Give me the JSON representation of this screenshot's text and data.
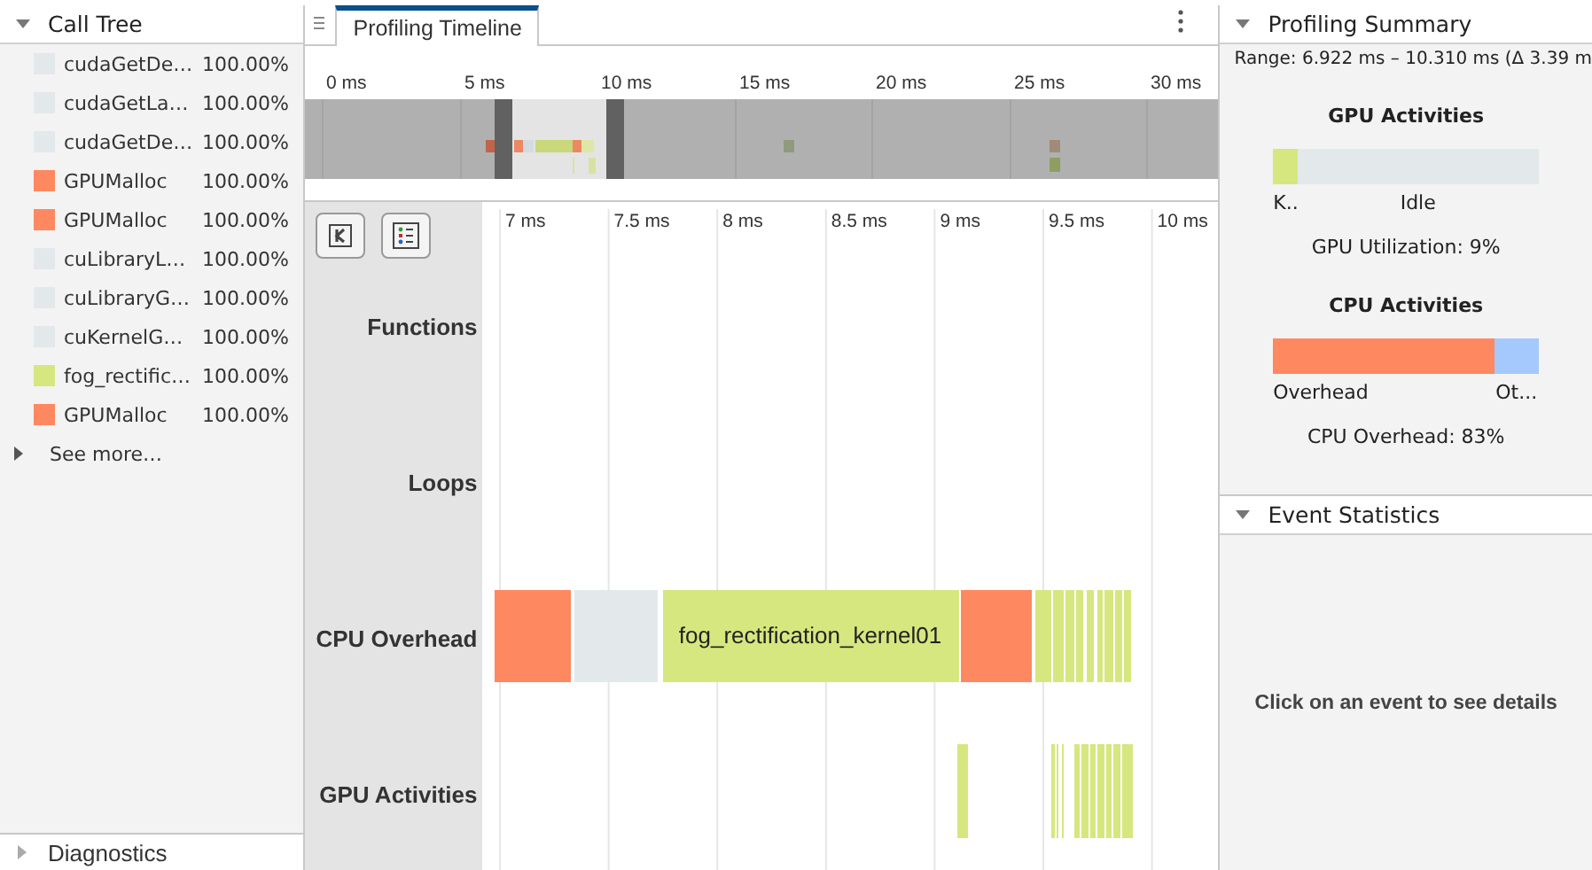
{
  "call_tree": {
    "title": "Call Tree",
    "items": [
      {
        "name": "cudaGetDe…",
        "percent": "100.00%",
        "color": "#e3e8eb"
      },
      {
        "name": "cudaGetLa…",
        "percent": "100.00%",
        "color": "#e3e8eb"
      },
      {
        "name": "cudaGetDe…",
        "percent": "100.00%",
        "color": "#e3e8eb"
      },
      {
        "name": "GPUMalloc",
        "percent": "100.00%",
        "color": "#fe8860"
      },
      {
        "name": "GPUMalloc",
        "percent": "100.00%",
        "color": "#fe8860"
      },
      {
        "name": "cuLibraryL…",
        "percent": "100.00%",
        "color": "#e3e8eb"
      },
      {
        "name": "cuLibraryG…",
        "percent": "100.00%",
        "color": "#e3e8eb"
      },
      {
        "name": "cuKernelG…",
        "percent": "100.00%",
        "color": "#e3e8eb"
      },
      {
        "name": "fog_rectific…",
        "percent": "100.00%",
        "color": "#d6e77f"
      },
      {
        "name": "GPUMalloc",
        "percent": "100.00%",
        "color": "#fe8860"
      }
    ],
    "see_more": "See more…",
    "expanded": true
  },
  "diagnostics": {
    "title": "Diagnostics",
    "expanded": false
  },
  "timeline": {
    "tab": "Profiling Timeline",
    "overview_ticks": [
      "0 ms",
      "5 ms",
      "10 ms",
      "15 ms",
      "20 ms",
      "25 ms",
      "30 ms"
    ],
    "detail_ticks": [
      "7 ms",
      "7.5 ms",
      "8 ms",
      "8.5 ms",
      "9 ms",
      "9.5 ms",
      "10 ms"
    ],
    "tracks": [
      {
        "label": "Functions"
      },
      {
        "label": "Loops"
      },
      {
        "label": "CPU Overhead",
        "event_label": "fog_rectification_kernel01"
      },
      {
        "label": "GPU Activities"
      }
    ]
  },
  "summary": {
    "title": "Profiling Summary",
    "range": "Range: 6.922 ms – 10.310 ms (Δ 3.39 m",
    "expanded": true,
    "gpu": {
      "title": "GPU Activities",
      "level": 0.09,
      "segments": [
        {
          "label": "K..",
          "color": "#d6e77f"
        },
        {
          "label": "Idle",
          "color": "#e3e8eb"
        }
      ],
      "caption": "GPU Utilization: 9%"
    },
    "cpu": {
      "title": "CPU Activities",
      "level": 0.83,
      "segments": [
        {
          "label": "Overhead",
          "color": "#fe8860"
        },
        {
          "label": "Ot...",
          "color": "#a5c8fd"
        }
      ],
      "caption": "CPU Overhead: 83%"
    }
  },
  "event_statistics": {
    "title": "Event Statistics",
    "expanded": true,
    "message": "Click on an event to see details"
  }
}
